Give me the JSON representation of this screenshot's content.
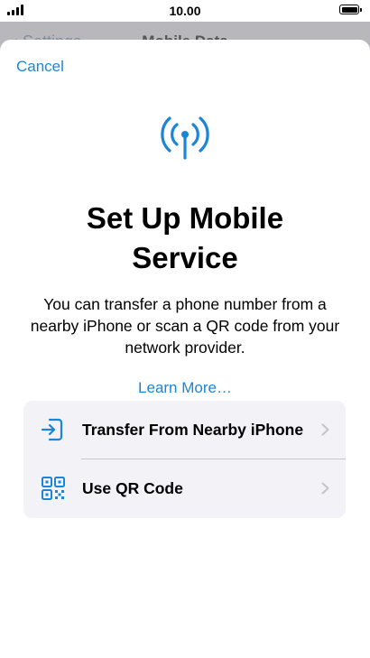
{
  "status_bar": {
    "time": "10.00",
    "signal_bars": 4,
    "battery_level": 1.0
  },
  "behind_header": {
    "back_label": "‹ Settings",
    "title": "Mobile Data"
  },
  "sheet": {
    "cancel_label": "Cancel",
    "icon": "antenna-radiowaves-icon",
    "title": "Set Up Mobile Service",
    "description": "You can transfer a phone number from a nearby iPhone or scan a QR code from your network provider.",
    "learn_more_label": "Learn More…"
  },
  "options": [
    {
      "label": "Transfer From Nearby iPhone",
      "icon": "transfer-in-icon"
    },
    {
      "label": "Use QR Code",
      "icon": "qr-code-icon"
    }
  ],
  "colors": {
    "accent": "#1a86d8",
    "list_background": "#f2f2f7",
    "chevron": "#c4c4c7"
  }
}
